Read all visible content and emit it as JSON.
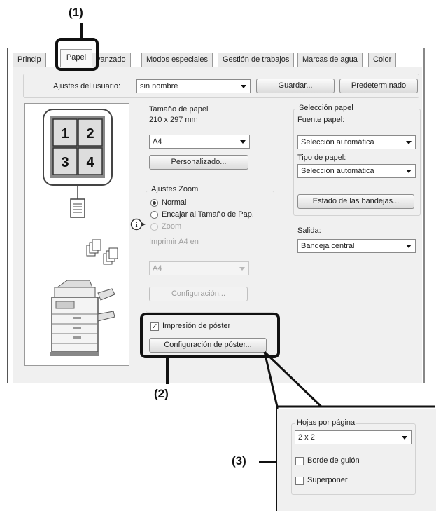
{
  "callouts": {
    "c1": "(1)",
    "c2": "(2)",
    "c3": "(3)"
  },
  "tabs": [
    {
      "label": "Princip"
    },
    {
      "label": "Papel"
    },
    {
      "label": "vanzado"
    },
    {
      "label": "Modos especiales"
    },
    {
      "label": "Gestión de trabajos"
    },
    {
      "label": "Marcas de agua"
    },
    {
      "label": "Color"
    }
  ],
  "user_settings": {
    "label": "Ajustes del usuario:",
    "value": "sin nombre",
    "save_button": "Guardar...",
    "default_button": "Predeterminado"
  },
  "preview": {
    "tiles": [
      "1",
      "2",
      "3",
      "4"
    ],
    "icons": [
      "poster-preview-icon",
      "document-icon",
      "collate-icon",
      "printer-icon",
      "info-icon"
    ]
  },
  "paper_size": {
    "group_title": "Tamaño de papel",
    "dimensions": "210 x 297 mm",
    "value": "A4",
    "custom_button": "Personalizado..."
  },
  "zoom_settings": {
    "group_title": "Ajustes Zoom",
    "options": [
      "Normal",
      "Encajar al Tamaño de Pap.",
      "Zoom"
    ],
    "selected": "Normal",
    "print_on_label": "Imprimir A4 en",
    "print_on_value": "A4",
    "config_button": "Configuración..."
  },
  "poster": {
    "checkbox_label": "Impresión de póster",
    "checked": true,
    "config_button": "Configuración de póster..."
  },
  "paper_selection": {
    "group_title": "Selección papel",
    "source_label": "Fuente papel:",
    "source_value": "Selección automática",
    "type_label": "Tipo de papel:",
    "type_value": "Selección automática",
    "trays_button": "Estado de las bandejas..."
  },
  "output": {
    "label": "Salida:",
    "value": "Bandeja central"
  },
  "poster_dialog": {
    "group_title": "Hojas por página",
    "value": "2 x 2",
    "option_border": "Borde de guión",
    "option_overlap": "Superponer"
  }
}
